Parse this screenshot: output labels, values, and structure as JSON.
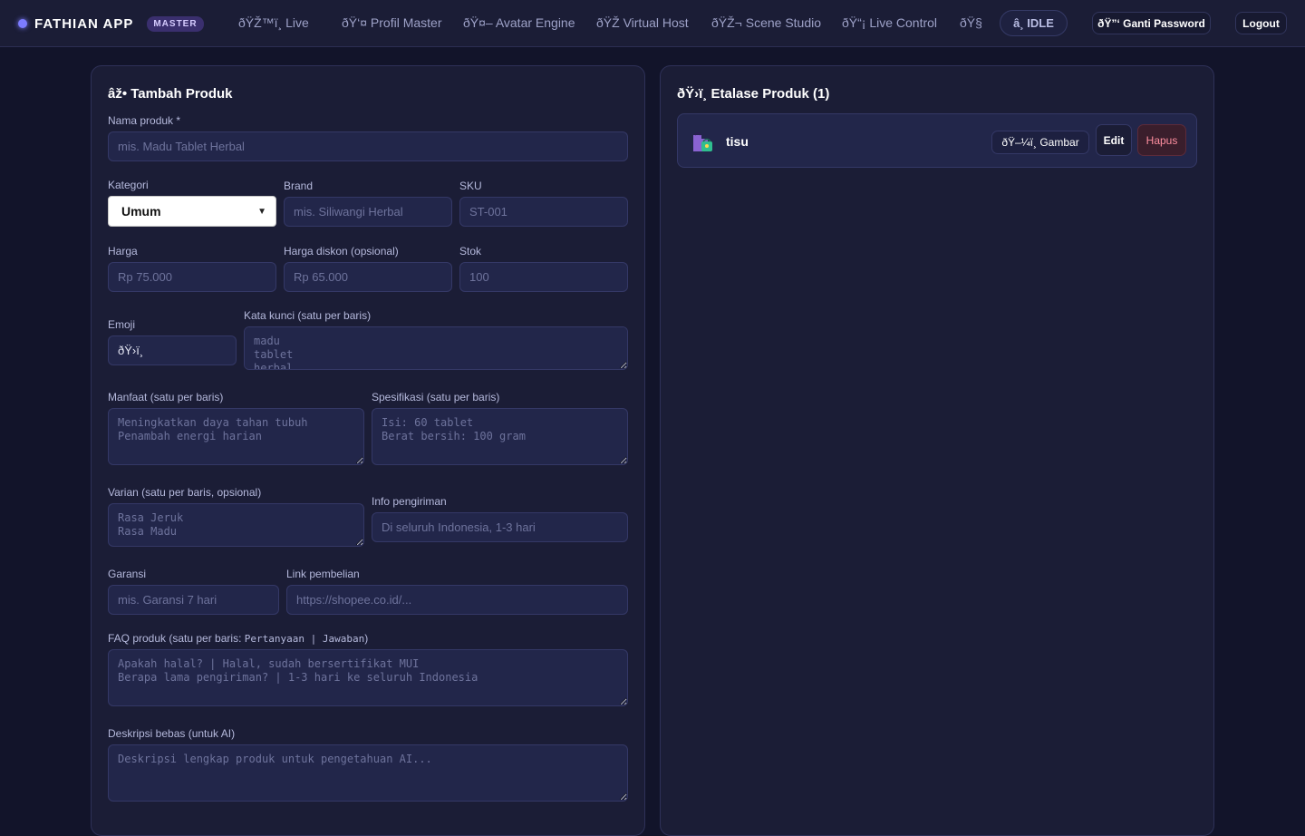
{
  "nav": {
    "brand": "FATHIAN APP",
    "badge": "MASTER",
    "links": [
      "ðŸŽ™ï¸ Live",
      "ðŸ‘¤ Profil Master",
      "ðŸ¤– Avatar Engine",
      "ðŸŽ Virtual Host",
      "ðŸŽ¬ Scene Studio",
      "ðŸ“¡ Live Control",
      "ðŸ§"
    ],
    "status": "â¸ IDLE",
    "change_password": "ðŸ”‘ Ganti Password",
    "logout": "Logout"
  },
  "form": {
    "title": "âž• Tambah Produk",
    "name": {
      "label": "Nama produk *",
      "placeholder": "mis. Madu Tablet Herbal"
    },
    "category": {
      "label": "Kategori",
      "value": "Umum"
    },
    "brand": {
      "label": "Brand",
      "placeholder": "mis. Siliwangi Herbal"
    },
    "sku": {
      "label": "SKU",
      "placeholder": "ST-001"
    },
    "price": {
      "label": "Harga",
      "placeholder": "Rp 75.000"
    },
    "discount": {
      "label": "Harga diskon (opsional)",
      "placeholder": "Rp 65.000"
    },
    "stock": {
      "label": "Stok",
      "placeholder": "100"
    },
    "emoji": {
      "label": "Emoji",
      "value": "ðŸ›ï¸"
    },
    "keywords": {
      "label": "Kata kunci (satu per baris)",
      "placeholder": "madu\ntablet\nherbal"
    },
    "benefits": {
      "label": "Manfaat (satu per baris)",
      "placeholder": "Meningkatkan daya tahan tubuh\nPenambah energi harian"
    },
    "specs": {
      "label": "Spesifikasi (satu per baris)",
      "placeholder": "Isi: 60 tablet\nBerat bersih: 100 gram"
    },
    "variants": {
      "label": "Varian (satu per baris, opsional)",
      "placeholder": "Rasa Jeruk\nRasa Madu"
    },
    "shipping": {
      "label": "Info pengiriman",
      "placeholder": "Di seluruh Indonesia, 1-3 hari"
    },
    "warranty": {
      "label": "Garansi",
      "placeholder": "mis. Garansi 7 hari"
    },
    "buy_link": {
      "label": "Link pembelian",
      "placeholder": "https://shopee.co.id/..."
    },
    "faq": {
      "label_prefix": "FAQ produk (satu per baris: ",
      "label_code": "Pertanyaan | Jawaban",
      "label_suffix": ")",
      "placeholder": "Apakah halal? | Halal, sudah bersertifikat MUI\nBerapa lama pengiriman? | 1-3 hari ke seluruh Indonesia"
    },
    "description": {
      "label": "Deskripsi bebas (untuk AI)",
      "placeholder": "Deskripsi lengkap produk untuk pengetahuan AI..."
    }
  },
  "catalog": {
    "title": "ðŸ›ï¸ Etalase Produk (1)",
    "items": [
      {
        "name": "tisu",
        "image_label": "ðŸ–¼ï¸ Gambar",
        "edit_label": "Edit",
        "delete_label": "Hapus"
      }
    ]
  }
}
